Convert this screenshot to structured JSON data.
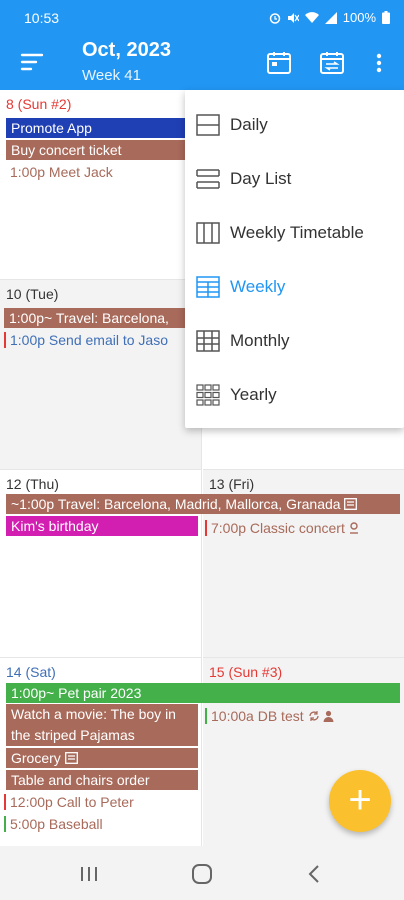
{
  "status": {
    "time": "10:53",
    "battery": "100%"
  },
  "header": {
    "title": "Oct, 2023",
    "subtitle": "Week 41"
  },
  "days": {
    "sun8": {
      "label": "8 (Sun #2)"
    },
    "tue10": {
      "label": "10 (Tue)"
    },
    "thu12": {
      "label": "12 (Thu)"
    },
    "fri13": {
      "label": "13 (Fri)"
    },
    "sat14": {
      "label": "14 (Sat)"
    },
    "sun15": {
      "label": "15 (Sun #3)"
    }
  },
  "events": {
    "promote_app": "Promote App",
    "buy_concert": "Buy concert ticket",
    "meet_jack": "1:00p Meet Jack",
    "travel_short": "1:00p~ Travel: Barcelona,",
    "send_email": "1:00p Send email to Jaso",
    "travel_long": "~1:00p Travel: Barcelona, Madrid, Mallorca, Granada",
    "kims_birthday": "Kim's birthday",
    "classic_concert": "7:00p Classic concert",
    "pet_pair": "1:00p~ Pet pair 2023",
    "movie": "Watch a movie: The boy in the striped Pajamas",
    "grocery": "Grocery",
    "table_chairs": "Table and chairs order",
    "call_peter": "12:00p Call to Peter",
    "baseball": "5:00p Baseball",
    "db_test": "10:00a DB test"
  },
  "view_menu": {
    "items": [
      {
        "label": "Daily",
        "icon": "daily-icon"
      },
      {
        "label": "Day List",
        "icon": "day-list-icon"
      },
      {
        "label": "Weekly Timetable",
        "icon": "weekly-timetable-icon"
      },
      {
        "label": "Weekly",
        "icon": "weekly-icon",
        "selected": true
      },
      {
        "label": "Monthly",
        "icon": "monthly-icon"
      },
      {
        "label": "Yearly",
        "icon": "yearly-icon"
      }
    ]
  },
  "fab": {
    "label": "+"
  },
  "colors": {
    "primary": "#2196f3",
    "event_brown": "#a86a5a",
    "event_navy": "#1f3fb5",
    "event_magenta": "#d21fb2",
    "event_green": "#43b04a",
    "fab": "#fbc02d"
  }
}
